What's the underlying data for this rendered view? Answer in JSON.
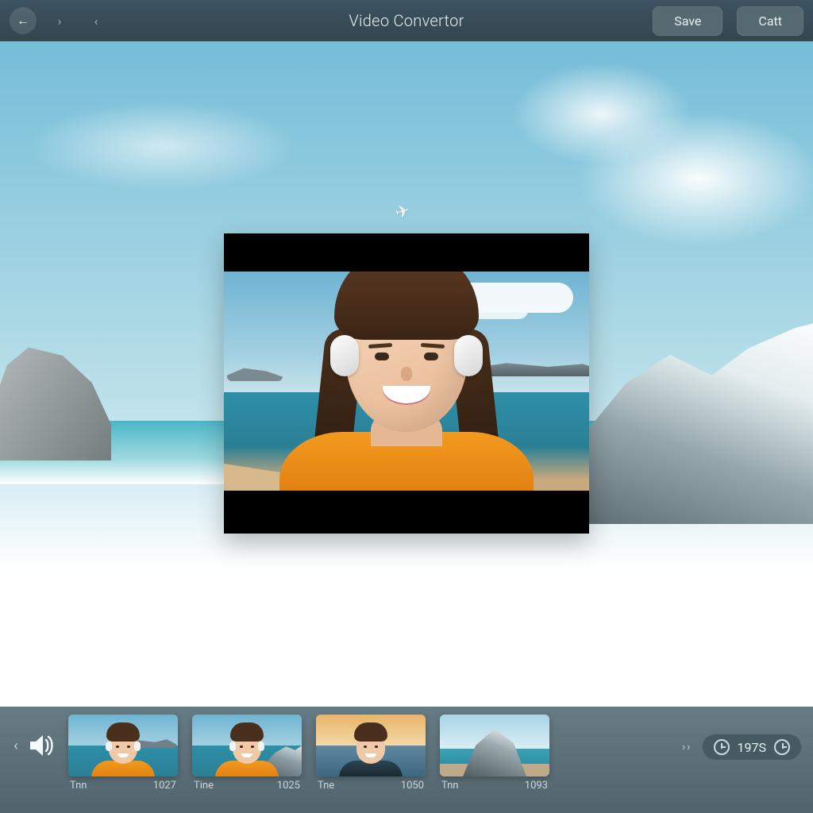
{
  "header": {
    "title": "Video Convertor",
    "save_label": "Save",
    "exit_label": "Catt"
  },
  "footer": {
    "timecode": "197S"
  },
  "thumbnails": [
    {
      "label": "Tnn",
      "value": "1027"
    },
    {
      "label": "Tine",
      "value": "1025"
    },
    {
      "label": "Tne",
      "value": "1050"
    },
    {
      "label": "Tnn",
      "value": "1093"
    }
  ]
}
